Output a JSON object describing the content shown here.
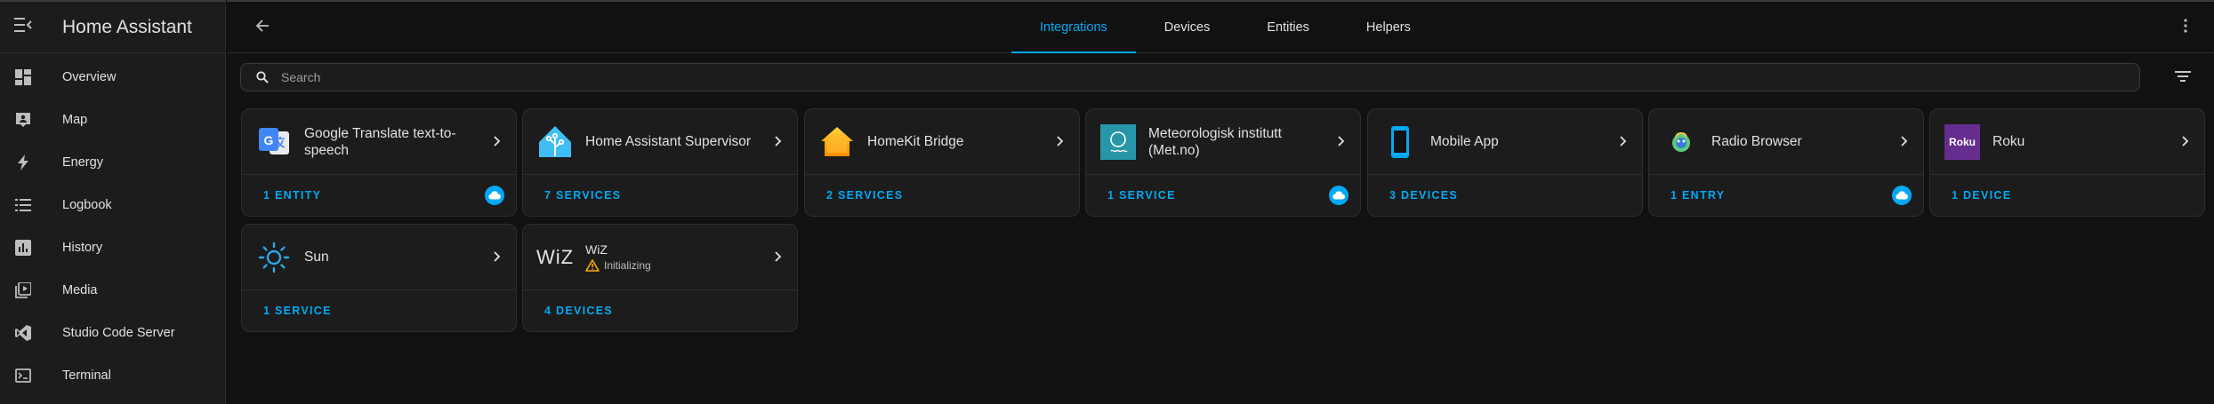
{
  "app": {
    "title": "Home Assistant"
  },
  "sidebar": {
    "items": [
      {
        "label": "Overview",
        "icon": "dashboard-icon"
      },
      {
        "label": "Map",
        "icon": "map-person-icon"
      },
      {
        "label": "Energy",
        "icon": "lightning-icon"
      },
      {
        "label": "Logbook",
        "icon": "format-list-icon"
      },
      {
        "label": "History",
        "icon": "chart-box-icon"
      },
      {
        "label": "Media",
        "icon": "play-box-icon"
      },
      {
        "label": "Studio Code Server",
        "icon": "vscode-icon"
      },
      {
        "label": "Terminal",
        "icon": "console-icon"
      }
    ]
  },
  "header": {
    "tabs": [
      {
        "label": "Integrations",
        "active": true
      },
      {
        "label": "Devices",
        "active": false
      },
      {
        "label": "Entities",
        "active": false
      },
      {
        "label": "Helpers",
        "active": false
      }
    ]
  },
  "search": {
    "placeholder": "Search",
    "value": ""
  },
  "colors": {
    "accent": "#03a9f4",
    "background": "#111111",
    "card": "#1c1c1c",
    "warning": "#ffa600"
  },
  "integrations": [
    {
      "name": "Google Translate text-to-speech",
      "link": "1 ENTITY",
      "cloud": true,
      "logo": "google-translate-logo-icon"
    },
    {
      "name": "Home Assistant Supervisor",
      "link": "7 SERVICES",
      "cloud": false,
      "logo": "home-assistant-logo-icon"
    },
    {
      "name": "HomeKit Bridge",
      "link": "2 SERVICES",
      "cloud": false,
      "logo": "homekit-logo-icon"
    },
    {
      "name": "Meteorologisk institutt (Met.no)",
      "link": "1 SERVICE",
      "cloud": true,
      "logo": "met-no-logo-icon"
    },
    {
      "name": "Mobile App",
      "link": "3 DEVICES",
      "cloud": false,
      "logo": "mobile-app-logo-icon"
    },
    {
      "name": "Radio Browser",
      "link": "1 ENTRY",
      "cloud": true,
      "logo": "radio-browser-logo-icon"
    },
    {
      "name": "Roku",
      "link": "1 DEVICE",
      "cloud": false,
      "logo": "roku-logo-icon",
      "logo_text": "Roku"
    },
    {
      "name": "Sun",
      "link": "1 SERVICE",
      "cloud": false,
      "logo": "sun-logo-icon"
    },
    {
      "name": "WiZ",
      "status": "Initializing",
      "link": "4 DEVICES",
      "cloud": false,
      "logo": "wiz-logo-icon",
      "logo_text": "WiZ"
    }
  ]
}
